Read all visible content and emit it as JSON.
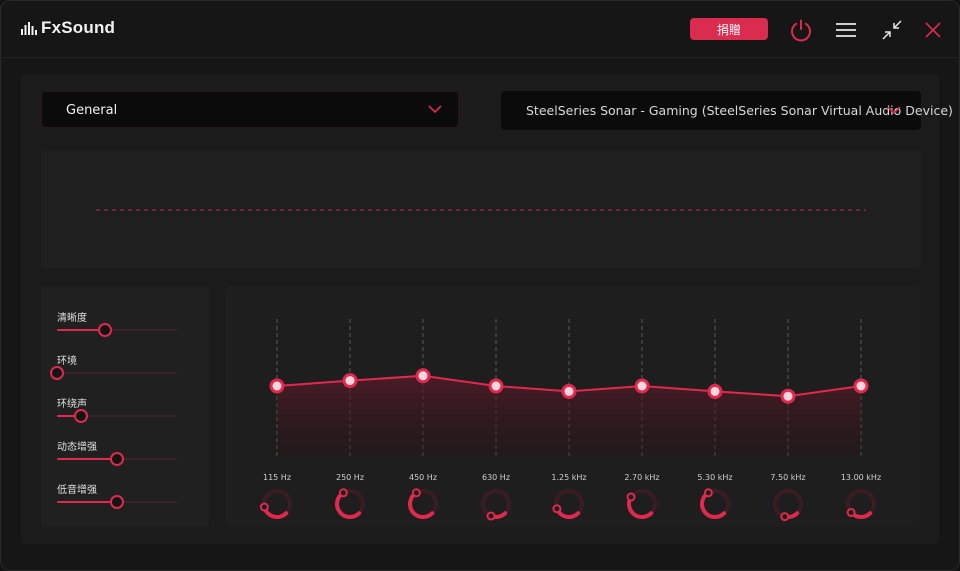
{
  "app": {
    "name": "FxSound"
  },
  "titlebar": {
    "donate_label": "捐贈"
  },
  "preset": {
    "selected": "General"
  },
  "output_device": {
    "selected": "SteelSeries Sonar - Gaming (SteelSeries Sonar Virtual Audio Device)"
  },
  "effects": [
    {
      "label": "清晰度",
      "level": 0.4
    },
    {
      "label": "环境",
      "level": 0.0
    },
    {
      "label": "环绕声",
      "level": 0.2
    },
    {
      "label": "动态增强",
      "level": 0.5
    },
    {
      "label": "低音增强",
      "level": 0.5
    }
  ],
  "eq": {
    "bands": [
      {
        "label": "115 Hz",
        "gain": 0.0
      },
      {
        "label": "250 Hz",
        "gain": 0.9
      },
      {
        "label": "450 Hz",
        "gain": 1.7
      },
      {
        "label": "630 Hz",
        "gain": 0.0
      },
      {
        "label": "1.25 kHz",
        "gain": -0.9
      },
      {
        "label": "2.70 kHz",
        "gain": 0.0
      },
      {
        "label": "5.30 kHz",
        "gain": -0.9
      },
      {
        "label": "7.50 kHz",
        "gain": -1.7
      },
      {
        "label": "13.00 kHz",
        "gain": 0.0
      }
    ],
    "knobs": [
      0.45,
      0.72,
      0.72,
      0.25,
      0.42,
      0.62,
      0.72,
      0.22,
      0.35
    ]
  },
  "colors": {
    "accent": "#e0294f",
    "donate": "#d92c4f",
    "background": "#161616",
    "panel": "#1b1b1b"
  },
  "icons": [
    "fxsound-logo-icon",
    "power-icon",
    "menu-icon",
    "minimize-icon",
    "close-icon",
    "chevron-down-icon"
  ]
}
